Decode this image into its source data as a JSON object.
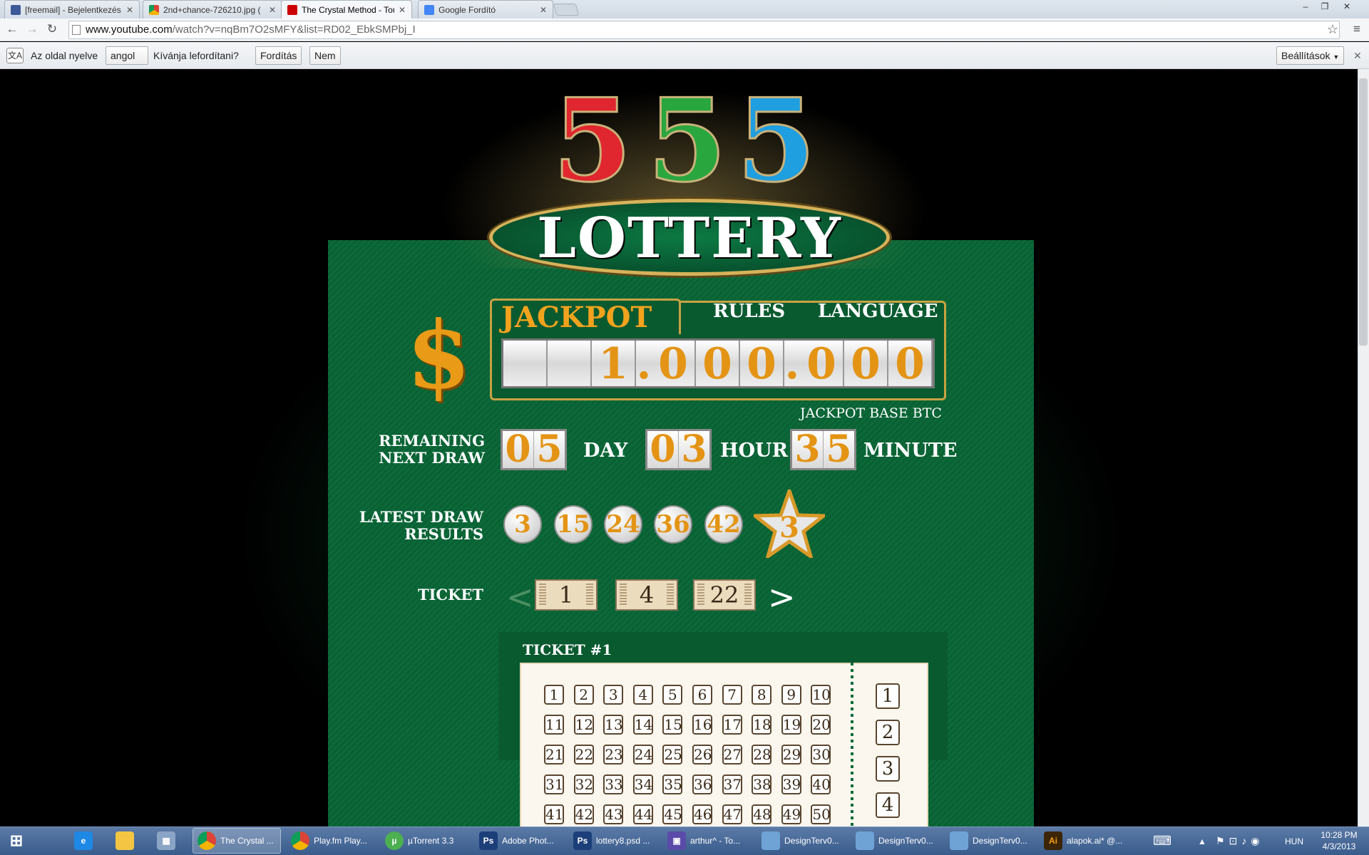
{
  "browser": {
    "tabs": [
      {
        "label": "[freemail] - Bejelentkezés",
        "icon": "freemail-icon",
        "color": "#3b5998"
      },
      {
        "label": "2nd+chance-726210.jpg (",
        "icon": "chrome-image-icon",
        "color": "#4caf50"
      },
      {
        "label": "The Crystal Method - Tou",
        "icon": "youtube-icon",
        "color": "#cc0000"
      },
      {
        "label": "Google Fordító",
        "icon": "google-translate-icon",
        "color": "#4285f4"
      }
    ],
    "url_host": "www.youtube.com",
    "url_path": "/watch?v=nqBm7O2sMFY&list=RD02_EbkSMPbj_I"
  },
  "translate_bar": {
    "prefix": "Az oldal nyelve",
    "language": "angol",
    "question": "Kívánja lefordítani?",
    "translate_button": "Fordítás",
    "no_button": "Nem",
    "settings_button": "Beállítások"
  },
  "game": {
    "logo_digits": [
      "5",
      "5",
      "5"
    ],
    "logo_colors": [
      "#e0262e",
      "#2aa63f",
      "#1f9ee0"
    ],
    "logo_word": "LOTTERY",
    "dollar": "$",
    "jackpot_label": "JACKPOT",
    "rules_link": "RULES",
    "language_link": "LANGUAGE",
    "jackpot_digits": [
      "",
      "",
      "1",
      ".",
      "0",
      "0",
      "0",
      ".",
      "0",
      "0",
      "0"
    ],
    "jackpot_base": "JACKPOT BASE BTC",
    "remaining_line1": "REMAINING",
    "remaining_line2": "NEXT DRAW",
    "days": [
      "0",
      "5"
    ],
    "day_label": "DAY",
    "hours": [
      "0",
      "3"
    ],
    "hour_label": "HOUR",
    "minutes": [
      "3",
      "5"
    ],
    "minute_label": "MINUTE",
    "latest_line1": "LATEST DRAW",
    "latest_line2": "RESULTS",
    "draw_balls": [
      "3",
      "15",
      "24",
      "36",
      "42"
    ],
    "star_ball": "3",
    "ticket_label": "TICKET",
    "ticket_prev": "<",
    "ticket_next": ">",
    "ticket_numbers": [
      "1",
      "4",
      "22"
    ],
    "ticket_title": "TICKET #1",
    "grid_numbers": [
      1,
      2,
      3,
      4,
      5,
      6,
      7,
      8,
      9,
      10,
      11,
      12,
      13,
      14,
      15,
      16,
      17,
      18,
      19,
      20,
      21,
      22,
      23,
      24,
      25,
      26,
      27,
      28,
      29,
      30,
      31,
      32,
      33,
      34,
      35,
      36,
      37,
      38,
      39,
      40,
      41,
      42,
      43,
      44,
      45,
      46,
      47,
      48,
      49,
      50
    ],
    "star_numbers": [
      1,
      2,
      3,
      4
    ]
  },
  "taskbar": {
    "items": [
      {
        "label": "",
        "icon": "start-icon"
      },
      {
        "label": "",
        "icon": "ie-icon"
      },
      {
        "label": "",
        "icon": "explorer-icon"
      },
      {
        "label": "",
        "icon": "calculator-icon"
      },
      {
        "label": "The Crystal ...",
        "icon": "chrome-icon"
      },
      {
        "label": "Play.fm Play...",
        "icon": "chrome-icon"
      },
      {
        "label": "µTorrent 3.3",
        "icon": "utorrent-icon"
      },
      {
        "label": "Adobe Phot...",
        "icon": "photoshop-icon"
      },
      {
        "label": "lottery8.psd ...",
        "icon": "photoshop-icon"
      },
      {
        "label": "arthur^ - To...",
        "icon": "floppy-icon"
      },
      {
        "label": "DesignTerv0...",
        "icon": "image-viewer-icon"
      },
      {
        "label": "DesignTerv0...",
        "icon": "image-viewer-icon"
      },
      {
        "label": "DesignTerv0...",
        "icon": "image-viewer-icon"
      },
      {
        "label": "alapok.ai* @...",
        "icon": "illustrator-icon"
      }
    ],
    "language": "HUN",
    "time": "10:28 PM",
    "date": "4/3/2013"
  }
}
